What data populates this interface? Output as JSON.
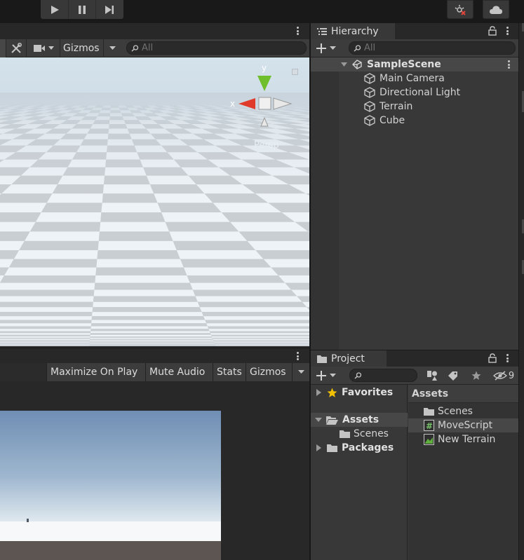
{
  "toolbar": {
    "play_icon": "play-icon",
    "pause_icon": "pause-icon",
    "step_icon": "step-icon",
    "collab_icon": "collab-icon",
    "cloud_icon": "cloud-icon"
  },
  "scene": {
    "gizmos_label": "Gizmos",
    "search_placeholder": "All",
    "axis_x": "x",
    "axis_y": "y",
    "projection_label": "Persp"
  },
  "game": {
    "maximize_label": "Maximize On Play",
    "mute_label": "Mute Audio",
    "stats_label": "Stats",
    "gizmos_label": "Gizmos"
  },
  "hierarchy": {
    "tab_label": "Hierarchy",
    "search_placeholder": "All",
    "scene_name": "SampleScene",
    "objects": [
      {
        "label": "Main Camera"
      },
      {
        "label": "Directional Light"
      },
      {
        "label": "Terrain"
      },
      {
        "label": "Cube"
      }
    ]
  },
  "project": {
    "tab_label": "Project",
    "hidden_count": "9",
    "tree": {
      "favorites": "Favorites",
      "assets": "Assets",
      "scenes": "Scenes",
      "packages": "Packages"
    },
    "content_header": "Assets",
    "items": [
      {
        "label": "Scenes",
        "icon": "folder-icon"
      },
      {
        "label": "MoveScript",
        "icon": "csharp-script-icon"
      },
      {
        "label": "New Terrain",
        "icon": "terrain-asset-icon"
      }
    ]
  },
  "colors": {
    "accent_selection": "#474747",
    "axis_x": "#e03a2a",
    "axis_y": "#6fbe2c",
    "favorite_star": "#f2c200"
  }
}
